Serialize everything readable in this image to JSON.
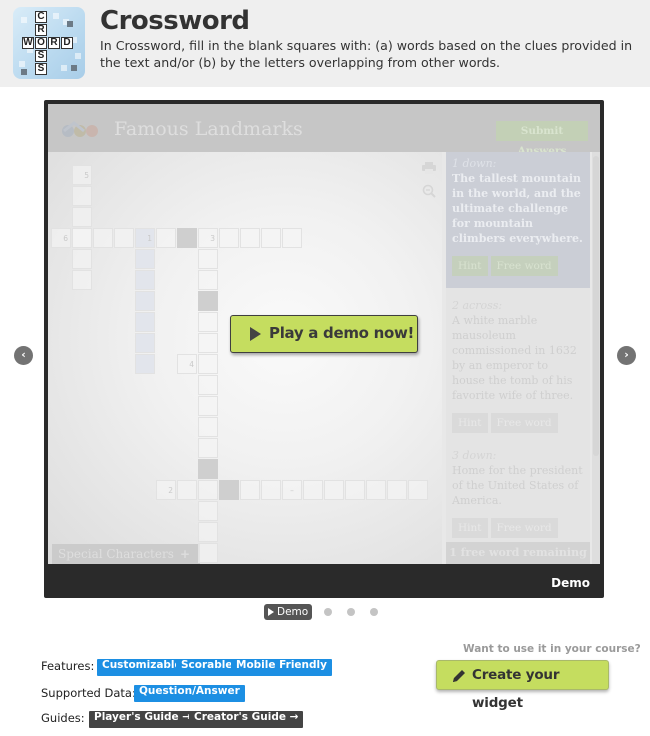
{
  "header": {
    "title": "Crossword",
    "description": "In Crossword, fill in the blank squares with: (a) words based on the clues provided in the text and/or (b) by the letters overlapping from other words.",
    "logo_letters_down": [
      "C",
      "R",
      "O",
      "S",
      "S"
    ],
    "logo_letters_across": [
      "W",
      "O",
      "R",
      "D"
    ]
  },
  "preview": {
    "game_title": "Famous Landmarks",
    "submit_label": "Submit Answers",
    "special_characters_label": "Special Characters",
    "special_characters_toggle": "+",
    "play_button_label": "Play a demo now!",
    "footer_label": "Demo",
    "grid_numbers": [
      "5",
      "6",
      "1",
      "3",
      "4",
      "2"
    ],
    "grid_dash": "–",
    "clues": [
      {
        "number": "1 down:",
        "text": "The tallest mountain in the world, and the ultimate challenge for mountain climbers everywhere.",
        "hint": "Hint",
        "free_word": "Free word",
        "active": true
      },
      {
        "number": "2 across:",
        "text": "A white marble mausoleum commissioned in 1632 by an emperor to house the tomb of his favorite wife of three.",
        "hint": "Hint",
        "free_word": "Free word",
        "active": false
      },
      {
        "number": "3 down:",
        "text": "Home for the president of the United States of America.",
        "hint": "Hint",
        "free_word": "Free word",
        "active": false
      }
    ],
    "free_words_remaining": "1 free word remaining"
  },
  "carousel": {
    "prev_icon": "chevron-left-icon",
    "next_icon": "chevron-right-icon",
    "active_slide_label": "Demo",
    "slide_count": 4,
    "active_index": 0
  },
  "info": {
    "features_label": "Features:",
    "features": [
      "Customizable",
      "Scorable",
      "Mobile Friendly"
    ],
    "supported_data_label": "Supported Data:",
    "supported_data": [
      "Question/Answer"
    ],
    "guides_label": "Guides:",
    "guides": [
      "Player's Guide →",
      "Creator's Guide →"
    ]
  },
  "cta": {
    "question": "Want to use it in your course?",
    "button_label": "Create your widget"
  },
  "colors": {
    "accent_green": "#c5dd5f",
    "tag_blue": "#1c8fe3",
    "tag_dark": "#444444"
  }
}
